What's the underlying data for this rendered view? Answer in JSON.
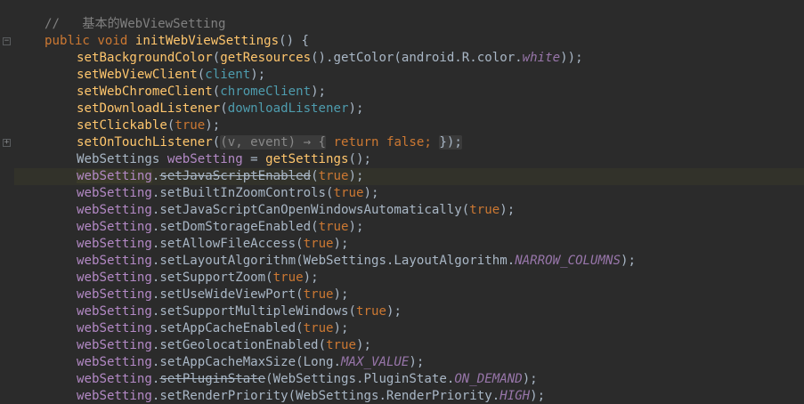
{
  "editor": {
    "comment": "//   基本的WebViewSetting",
    "method_sig": {
      "public_kw": "public",
      "void_kw": "void",
      "name": "initWebViewSettings",
      "parens": "() {"
    },
    "stmts": {
      "setBackgroundColor": {
        "call": "setBackgroundColor",
        "arg_call": "getResources",
        "mid": "().",
        "getColor": "getColor",
        "open": "(android.R.color.",
        "white": "white",
        "close": "));"
      },
      "setWebViewClient": {
        "call": "setWebViewClient",
        "open": "(",
        "arg": "client",
        "close": ");"
      },
      "setWebChromeClient": {
        "call": "setWebChromeClient",
        "open": "(",
        "arg": "chromeClient",
        "close": ");"
      },
      "setDownloadListener": {
        "call": "setDownloadListener",
        "open": "(",
        "arg": "downloadListener",
        "close": ");"
      },
      "setClickable": {
        "call": "setClickable",
        "open": "(",
        "val": "true",
        "close": ");"
      },
      "setOnTouchListener": {
        "call": "setOnTouchListener",
        "open": "(",
        "lambda": "(v, event) → {",
        "ret_kw": "return",
        "false_kw": "false",
        "semi": ";",
        "end": "});"
      },
      "webSettingsDecl": {
        "type": "WebSettings ",
        "var": "webSetting",
        "eq": " = ",
        "call": "getSettings",
        "end": "();"
      }
    },
    "ws_var": "webSetting",
    "ws_calls": [
      {
        "method": "setJavaScriptEnabled",
        "args": "true",
        "arg_kind": "kw",
        "deprecated": true
      },
      {
        "method": "setBuiltInZoomControls",
        "args": "true",
        "arg_kind": "kw",
        "deprecated": false
      },
      {
        "method": "setJavaScriptCanOpenWindowsAutomatically",
        "args": "true",
        "arg_kind": "kw",
        "deprecated": false
      },
      {
        "method": "setDomStorageEnabled",
        "args": "true",
        "arg_kind": "kw",
        "deprecated": false
      },
      {
        "method": "setAllowFileAccess",
        "args": "true",
        "arg_kind": "kw",
        "deprecated": false
      },
      {
        "method": "setLayoutAlgorithm",
        "args_prefix": "WebSettings.LayoutAlgorithm.",
        "args": "NARROW_COLUMNS",
        "arg_kind": "const",
        "deprecated": false
      },
      {
        "method": "setSupportZoom",
        "args": "true",
        "arg_kind": "kw",
        "deprecated": false
      },
      {
        "method": "setUseWideViewPort",
        "args": "true",
        "arg_kind": "kw",
        "deprecated": false
      },
      {
        "method": "setSupportMultipleWindows",
        "args": "true",
        "arg_kind": "kw",
        "deprecated": false
      },
      {
        "method": "setAppCacheEnabled",
        "args": "true",
        "arg_kind": "kw",
        "deprecated": false
      },
      {
        "method": "setGeolocationEnabled",
        "args": "true",
        "arg_kind": "kw",
        "deprecated": false
      },
      {
        "method": "setAppCacheMaxSize",
        "args_prefix": "Long.",
        "args": "MAX_VALUE",
        "arg_kind": "const",
        "deprecated": false
      },
      {
        "method": "setPluginState",
        "args_prefix": "WebSettings.PluginState.",
        "args": "ON_DEMAND",
        "arg_kind": "const",
        "deprecated": true
      },
      {
        "method": "setRenderPriority",
        "args_prefix": "WebSettings.RenderPriority.",
        "args": "HIGH",
        "arg_kind": "const",
        "deprecated": false
      }
    ],
    "colors": {
      "background": "#2b2b2b",
      "keyword": "#cc7832",
      "method": "#ffc66d",
      "local_var": "#b389c5",
      "field": "#4e9cae",
      "constant": "#9876aa",
      "comment": "#808080",
      "text": "#a9b7c6"
    }
  }
}
